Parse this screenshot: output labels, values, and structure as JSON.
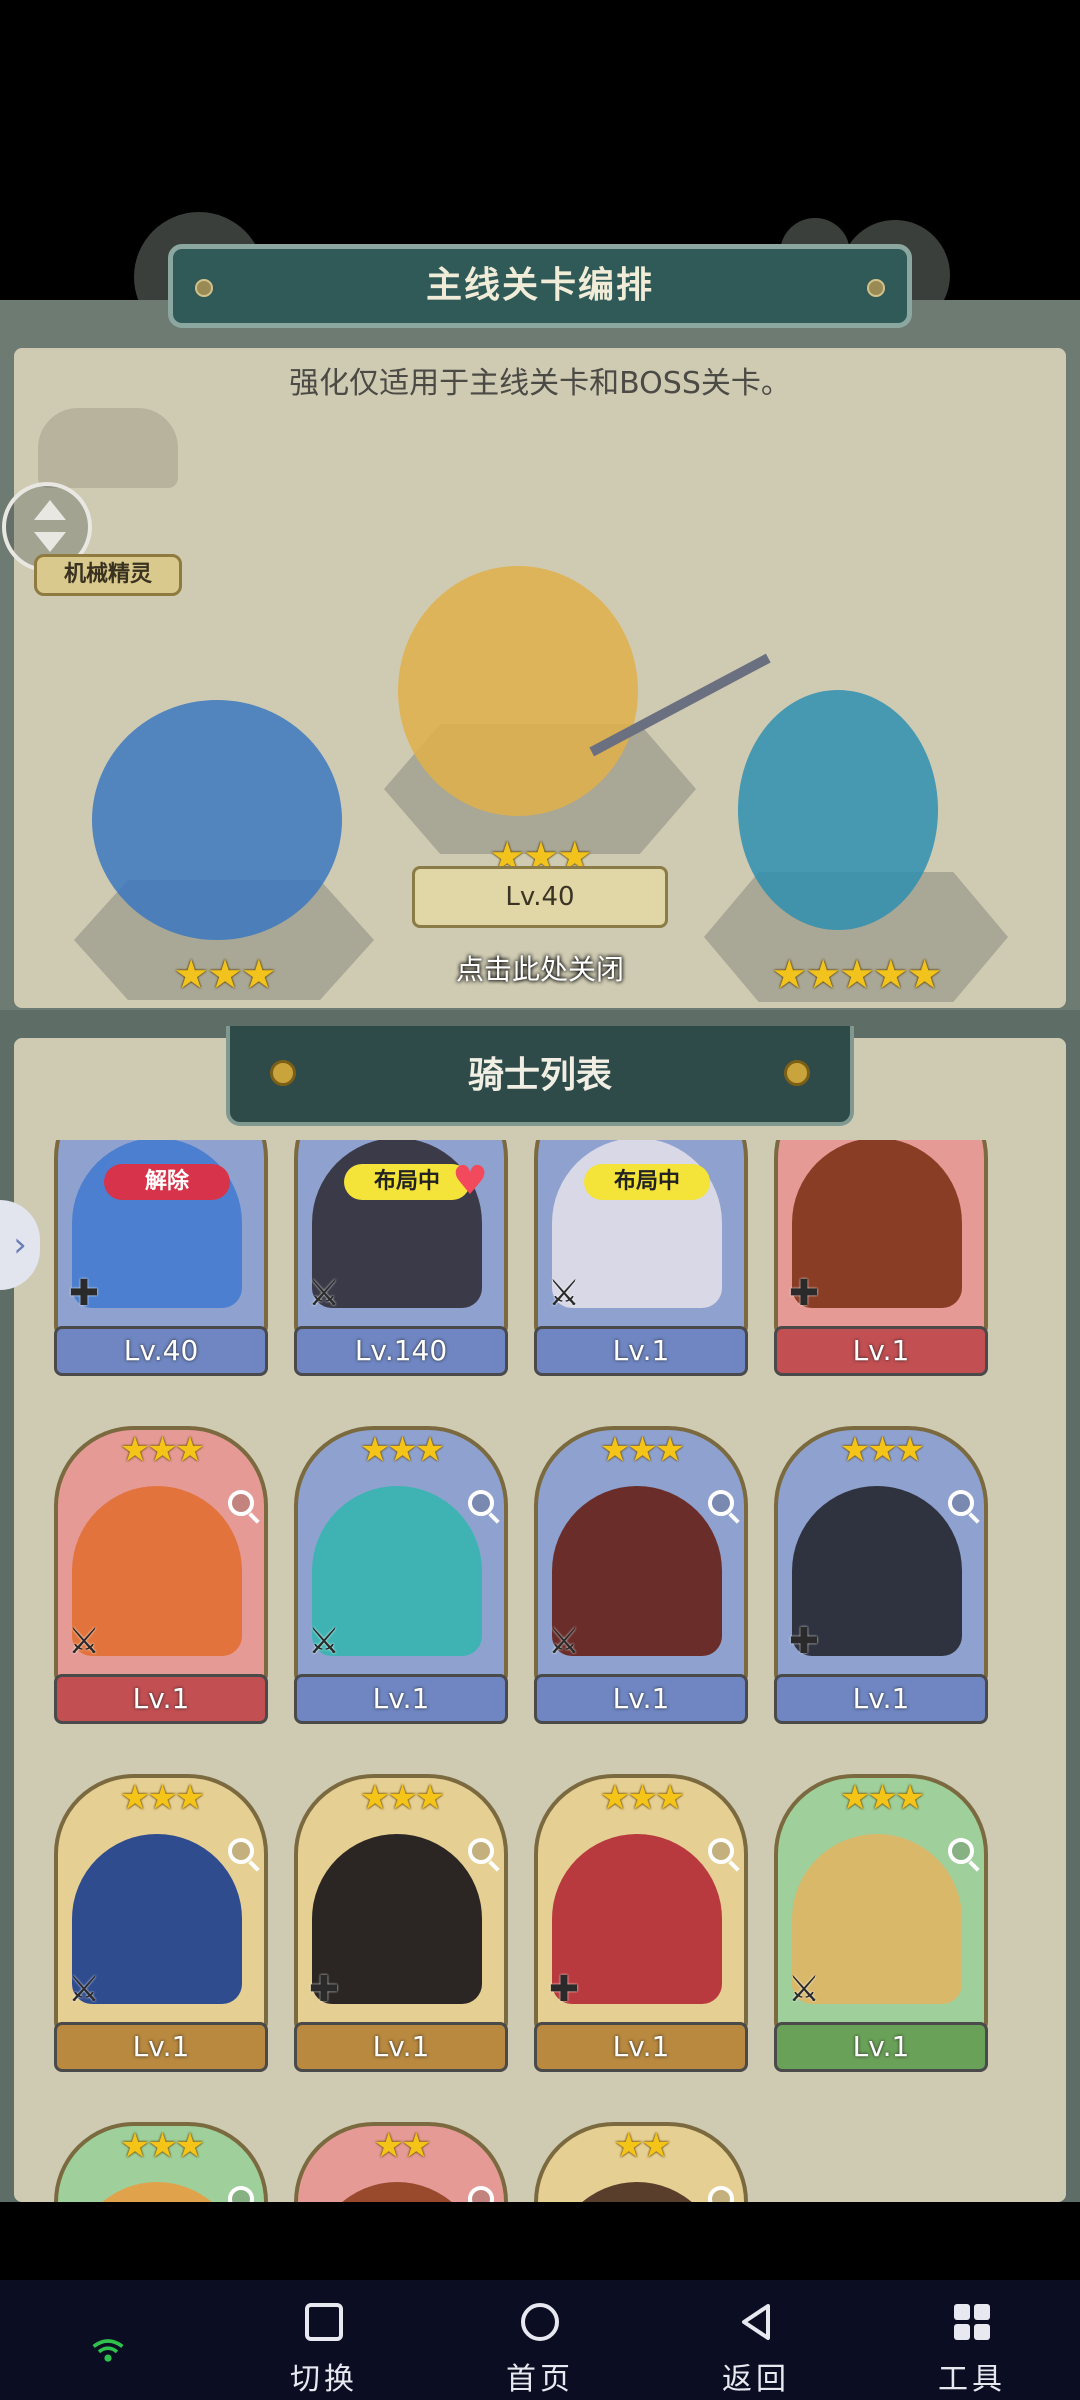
{
  "formation": {
    "title": "主线关卡编排",
    "hint": "强化仅适用于主线关卡和BOSS关卡。",
    "sprite_tag": "机械精灵",
    "center_level": "Lv.40",
    "close_hint": "点击此处关闭",
    "slots": [
      {
        "stars": "★★★",
        "color": "#3c78c0"
      },
      {
        "stars": "★★★",
        "color": "#e0b04a"
      },
      {
        "stars": "★★★★★",
        "color": "#2f8fb0"
      }
    ]
  },
  "knight_list": {
    "title": "骑士列表",
    "side_arrow": "›",
    "cards": [
      {
        "level": "Lv.40",
        "stars": "",
        "status": "解除",
        "status_color": "#d7334a",
        "frame": "#8fa2cf",
        "bar": "#6f86c2",
        "portrait": "#4c7fcf",
        "weapon": "✚",
        "heart": ""
      },
      {
        "level": "Lv.140",
        "stars": "",
        "status": "布局中",
        "status_color": "#f4e43a",
        "frame": "#8fa2cf",
        "bar": "#6f86c2",
        "portrait": "#3b3a48",
        "weapon": "⚔",
        "heart": "♥"
      },
      {
        "level": "Lv.1",
        "stars": "",
        "status": "布局中",
        "status_color": "#f4e43a",
        "frame": "#8fa2cf",
        "bar": "#6f86c2",
        "portrait": "#d8d8e6",
        "weapon": "⚔",
        "heart": ""
      },
      {
        "level": "Lv.1",
        "stars": "",
        "status": "",
        "status_color": "",
        "frame": "#e59a95",
        "bar": "#c24f52",
        "portrait": "#8a3d25",
        "weapon": "✚",
        "heart": ""
      },
      {
        "level": "Lv.1",
        "stars": "★★★",
        "status": "",
        "status_color": "",
        "frame": "#e59a95",
        "bar": "#c24f52",
        "portrait": "#e2733c",
        "weapon": "⚔",
        "heart": ""
      },
      {
        "level": "Lv.1",
        "stars": "★★★",
        "status": "",
        "status_color": "",
        "frame": "#8fa2cf",
        "bar": "#6f86c2",
        "portrait": "#3fb3b3",
        "weapon": "⚔",
        "heart": ""
      },
      {
        "level": "Lv.1",
        "stars": "★★★",
        "status": "",
        "status_color": "",
        "frame": "#8fa2cf",
        "bar": "#6f86c2",
        "portrait": "#6a2d2a",
        "weapon": "⚔",
        "heart": ""
      },
      {
        "level": "Lv.1",
        "stars": "★★★",
        "status": "",
        "status_color": "",
        "frame": "#8fa2cf",
        "bar": "#6f86c2",
        "portrait": "#2f3340",
        "weapon": "✚",
        "heart": ""
      },
      {
        "level": "Lv.1",
        "stars": "★★★",
        "status": "",
        "status_color": "",
        "frame": "#e6cf93",
        "bar": "#b8893f",
        "portrait": "#2f4c8f",
        "weapon": "⚔",
        "heart": ""
      },
      {
        "level": "Lv.1",
        "stars": "★★★",
        "status": "",
        "status_color": "",
        "frame": "#e6cf93",
        "bar": "#b8893f",
        "portrait": "#2b2624",
        "weapon": "✚",
        "heart": ""
      },
      {
        "level": "Lv.1",
        "stars": "★★★",
        "status": "",
        "status_color": "",
        "frame": "#e6cf93",
        "bar": "#b8893f",
        "portrait": "#b83a3f",
        "weapon": "✚",
        "heart": ""
      },
      {
        "level": "Lv.1",
        "stars": "★★★",
        "status": "",
        "status_color": "",
        "frame": "#9fcf9a",
        "bar": "#6aa158",
        "portrait": "#d9b86a",
        "weapon": "⚔",
        "heart": ""
      },
      {
        "level": "",
        "stars": "★★★",
        "status": "",
        "status_color": "",
        "frame": "#9fcf9a",
        "bar": "#6aa158",
        "portrait": "#e0a34c",
        "weapon": "",
        "heart": ""
      },
      {
        "level": "",
        "stars": "★★",
        "status": "",
        "status_color": "",
        "frame": "#e59a95",
        "bar": "#c24f52",
        "portrait": "#9a4a2c",
        "weapon": "",
        "heart": ""
      },
      {
        "level": "",
        "stars": "★★",
        "status": "",
        "status_color": "",
        "frame": "#e6cf93",
        "bar": "#b8893f",
        "portrait": "#5a3e2c",
        "weapon": "",
        "heart": ""
      }
    ]
  },
  "navbar": {
    "items": [
      {
        "label": "",
        "icon": "wifi-icon"
      },
      {
        "label": "切换",
        "icon": "square-icon"
      },
      {
        "label": "首页",
        "icon": "circle-icon"
      },
      {
        "label": "返回",
        "icon": "back-triangle-icon"
      },
      {
        "label": "工具",
        "icon": "grid-icon"
      }
    ]
  }
}
